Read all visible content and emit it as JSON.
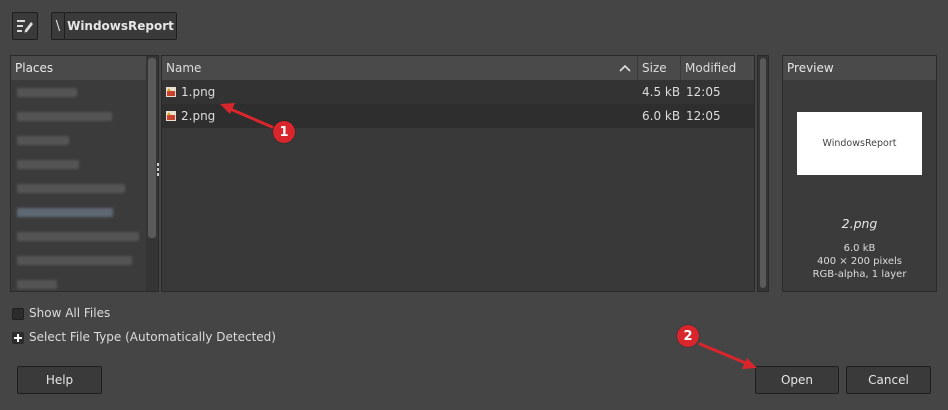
{
  "path_bar": {
    "edit_icon": "edit-location-icon",
    "separator": "\\",
    "current_folder": "WindowsReport"
  },
  "places": {
    "header": "Places"
  },
  "file_list": {
    "columns": {
      "name": "Name",
      "size": "Size",
      "modified": "Modified"
    },
    "sort_icon": "sort-ascending-icon",
    "rows": [
      {
        "name": "1.png",
        "size": "4.5 kB",
        "modified": "12:05"
      },
      {
        "name": "2.png",
        "size": "6.0 kB",
        "modified": "12:05"
      }
    ]
  },
  "preview": {
    "header": "Preview",
    "thumbnail_text": "WindowsReport",
    "filename": "2.png",
    "size": "6.0 kB",
    "dimensions": "400 × 200 pixels",
    "mode": "RGB-alpha, 1 layer"
  },
  "options": {
    "show_all_files": "Show All Files",
    "select_file_type": "Select File Type (Automatically Detected)"
  },
  "buttons": {
    "help": "Help",
    "open": "Open",
    "cancel": "Cancel"
  },
  "annotations": {
    "step1": "1",
    "step2": "2"
  },
  "colors": {
    "annotation_red": "#d9262c",
    "background": "#454545"
  }
}
